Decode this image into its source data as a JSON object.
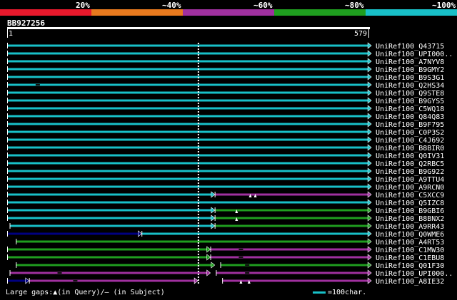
{
  "legend": {
    "segments": [
      {
        "label": "20%",
        "color": "#e8192c"
      },
      {
        "label": "~40%",
        "color": "#e87a1e"
      },
      {
        "label": "~60%",
        "color": "#a0309f"
      },
      {
        "label": "~80%",
        "color": "#1f9e1f"
      },
      {
        "label": "~100%",
        "color": "#18c0c8"
      }
    ]
  },
  "query": {
    "name": "BB927256",
    "start": "1",
    "end": "579"
  },
  "hits": [
    {
      "label": "UniRef100_Q43715",
      "segs": [
        {
          "from": 1,
          "to": 578,
          "color": "#18c0c8"
        }
      ],
      "gaps": [],
      "subjGaps": []
    },
    {
      "label": "UniRef100_UPI000..",
      "segs": [
        {
          "from": 1,
          "to": 578,
          "color": "#18c0c8"
        }
      ],
      "gaps": [],
      "subjGaps": []
    },
    {
      "label": "UniRef100_A7NYV8",
      "segs": [
        {
          "from": 1,
          "to": 578,
          "color": "#18c0c8"
        }
      ],
      "gaps": [],
      "subjGaps": []
    },
    {
      "label": "UniRef100_B9GMY2",
      "segs": [
        {
          "from": 1,
          "to": 578,
          "color": "#18c0c8"
        }
      ],
      "gaps": [],
      "subjGaps": []
    },
    {
      "label": "UniRef100_B9S3G1",
      "segs": [
        {
          "from": 1,
          "to": 578,
          "color": "#18c0c8"
        }
      ],
      "gaps": [],
      "subjGaps": []
    },
    {
      "label": "UniRef100_Q2HS34",
      "segs": [
        {
          "from": 1,
          "to": 578,
          "color": "#18c0c8"
        }
      ],
      "gaps": [],
      "subjGaps": [
        50
      ]
    },
    {
      "label": "UniRef100_Q9STE8",
      "segs": [
        {
          "from": 1,
          "to": 578,
          "color": "#18c0c8"
        }
      ],
      "gaps": [],
      "subjGaps": []
    },
    {
      "label": "UniRef100_B9GYS5",
      "segs": [
        {
          "from": 1,
          "to": 578,
          "color": "#18c0c8"
        }
      ],
      "gaps": [],
      "subjGaps": []
    },
    {
      "label": "UniRef100_C5WQ18",
      "segs": [
        {
          "from": 1,
          "to": 578,
          "color": "#18c0c8"
        }
      ],
      "gaps": [],
      "subjGaps": []
    },
    {
      "label": "UniRef100_Q84Q83",
      "segs": [
        {
          "from": 1,
          "to": 578,
          "color": "#18c0c8"
        }
      ],
      "gaps": [],
      "subjGaps": []
    },
    {
      "label": "UniRef100_B9F795",
      "segs": [
        {
          "from": 1,
          "to": 578,
          "color": "#18c0c8"
        }
      ],
      "gaps": [],
      "subjGaps": []
    },
    {
      "label": "UniRef100_C0P3S2",
      "segs": [
        {
          "from": 1,
          "to": 578,
          "color": "#18c0c8"
        }
      ],
      "gaps": [],
      "subjGaps": []
    },
    {
      "label": "UniRef100_C4J692",
      "segs": [
        {
          "from": 1,
          "to": 578,
          "color": "#18c0c8"
        }
      ],
      "gaps": [],
      "subjGaps": []
    },
    {
      "label": "UniRef100_B8BIR0",
      "segs": [
        {
          "from": 1,
          "to": 578,
          "color": "#18c0c8"
        }
      ],
      "gaps": [],
      "subjGaps": []
    },
    {
      "label": "UniRef100_Q0IV31",
      "segs": [
        {
          "from": 1,
          "to": 578,
          "color": "#18c0c8"
        }
      ],
      "gaps": [],
      "subjGaps": []
    },
    {
      "label": "UniRef100_Q2RBC5",
      "segs": [
        {
          "from": 1,
          "to": 578,
          "color": "#18c0c8"
        }
      ],
      "gaps": [],
      "subjGaps": []
    },
    {
      "label": "UniRef100_B9G922",
      "segs": [
        {
          "from": 1,
          "to": 578,
          "color": "#18c0c8"
        }
      ],
      "gaps": [],
      "subjGaps": []
    },
    {
      "label": "UniRef100_A9TTU4",
      "segs": [
        {
          "from": 1,
          "to": 578,
          "color": "#18c0c8"
        }
      ],
      "gaps": [],
      "subjGaps": []
    },
    {
      "label": "UniRef100_A9RCN0",
      "segs": [
        {
          "from": 1,
          "to": 578,
          "color": "#18c0c8"
        }
      ],
      "gaps": [],
      "subjGaps": []
    },
    {
      "label": "UniRef100_C5XCC9",
      "segs": [
        {
          "from": 1,
          "to": 332,
          "color": "#18c0c8"
        },
        {
          "from": 333,
          "to": 578,
          "color": "#a0309f"
        }
      ],
      "gaps": [
        390,
        398
      ],
      "subjGaps": []
    },
    {
      "label": "UniRef100_Q5IZC8",
      "segs": [
        {
          "from": 1,
          "to": 578,
          "color": "#18c0c8"
        }
      ],
      "gaps": [],
      "subjGaps": []
    },
    {
      "label": "UniRef100_B9GBI6",
      "segs": [
        {
          "from": 1,
          "to": 332,
          "color": "#18c0c8"
        },
        {
          "from": 333,
          "to": 578,
          "color": "#1f9e1f"
        }
      ],
      "gaps": [
        368
      ],
      "subjGaps": []
    },
    {
      "label": "UniRef100_B8BNX2",
      "segs": [
        {
          "from": 1,
          "to": 332,
          "color": "#18c0c8"
        },
        {
          "from": 333,
          "to": 578,
          "color": "#1f9e1f"
        }
      ],
      "gaps": [
        368
      ],
      "subjGaps": []
    },
    {
      "label": "UniRef100_A9RR43",
      "segs": [
        {
          "from": 5,
          "to": 332,
          "color": "#18c0c8"
        },
        {
          "from": 333,
          "to": 578,
          "color": "#1f9e1f"
        }
      ],
      "gaps": [],
      "subjGaps": []
    },
    {
      "label": "UniRef100_Q0WME6",
      "segs": [
        {
          "from": 1,
          "to": 215,
          "color": "#000080"
        },
        {
          "from": 216,
          "to": 578,
          "color": "#18c0c8"
        }
      ],
      "gaps": [],
      "subjGaps": []
    },
    {
      "label": "UniRef100_A4RT53",
      "segs": [
        {
          "from": 15,
          "to": 578,
          "color": "#1f9e1f"
        }
      ],
      "gaps": [],
      "subjGaps": []
    },
    {
      "label": "UniRef100_C1MW30",
      "segs": [
        {
          "from": 1,
          "to": 325,
          "color": "#1f9e1f"
        },
        {
          "from": 326,
          "to": 578,
          "color": "#a0309f"
        }
      ],
      "gaps": [],
      "subjGaps": [
        375
      ]
    },
    {
      "label": "UniRef100_C1EBU8",
      "segs": [
        {
          "from": 1,
          "to": 325,
          "color": "#1f9e1f"
        },
        {
          "from": 326,
          "to": 578,
          "color": "#a0309f"
        }
      ],
      "gaps": [],
      "subjGaps": [
        375
      ]
    },
    {
      "label": "UniRef100_Q01F30",
      "segs": [
        {
          "from": 15,
          "to": 332,
          "color": "#1f9e1f"
        },
        {
          "from": 342,
          "to": 578,
          "color": "#1f9e1f"
        }
      ],
      "gaps": [],
      "subjGaps": [
        385
      ]
    },
    {
      "label": "UniRef100_UPI000..",
      "segs": [
        {
          "from": 5,
          "to": 325,
          "color": "#a0309f"
        },
        {
          "from": 335,
          "to": 578,
          "color": "#a0309f"
        }
      ],
      "gaps": [],
      "subjGaps": [
        85,
        385
      ]
    },
    {
      "label": "UniRef100_A8IE32",
      "segs": [
        {
          "from": 1,
          "to": 35,
          "color": "#000080"
        },
        {
          "from": 36,
          "to": 305,
          "color": "#a0309f"
        },
        {
          "from": 345,
          "to": 578,
          "color": "#a0309f"
        }
      ],
      "gaps": [
        375,
        388
      ],
      "subjGaps": [
        110
      ]
    }
  ],
  "footer": {
    "text": "Large gaps:▲(in Query)/– (in Subject)",
    "scale": "=100char."
  },
  "scale_color": "#18c0c8"
}
